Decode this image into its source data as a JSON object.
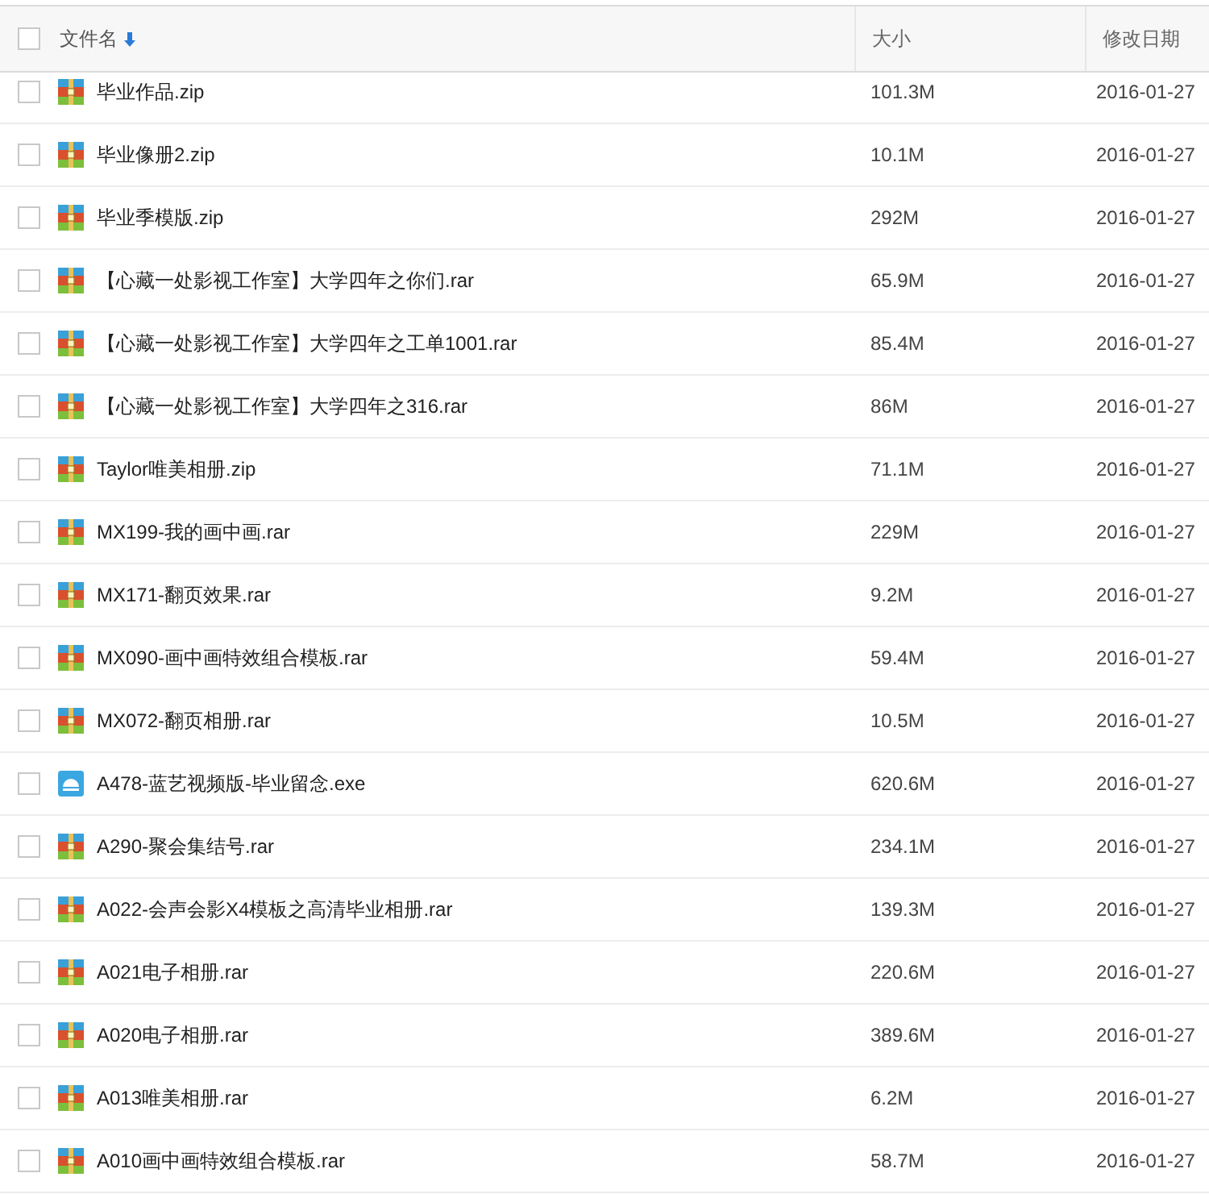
{
  "header": {
    "columns": [
      {
        "label": "文件名",
        "sorted": true
      },
      {
        "label": "大小",
        "sorted": false
      },
      {
        "label": "修改日期",
        "sorted": false
      }
    ],
    "checked": false
  },
  "rows": [
    {
      "name": "毕业作品.zip",
      "size": "101.3M",
      "date": "2016-01-27",
      "kind": "archive",
      "checked": false
    },
    {
      "name": "毕业像册2.zip",
      "size": "10.1M",
      "date": "2016-01-27",
      "kind": "archive",
      "checked": false
    },
    {
      "name": "毕业季模版.zip",
      "size": "292M",
      "date": "2016-01-27",
      "kind": "archive",
      "checked": false
    },
    {
      "name": "【心藏一处影视工作室】大学四年之你们.rar",
      "size": "65.9M",
      "date": "2016-01-27",
      "kind": "archive",
      "checked": false
    },
    {
      "name": "【心藏一处影视工作室】大学四年之工单1001.rar",
      "size": "85.4M",
      "date": "2016-01-27",
      "kind": "archive",
      "checked": false
    },
    {
      "name": "【心藏一处影视工作室】大学四年之316.rar",
      "size": "86M",
      "date": "2016-01-27",
      "kind": "archive",
      "checked": false
    },
    {
      "name": "Taylor唯美相册.zip",
      "size": "71.1M",
      "date": "2016-01-27",
      "kind": "archive",
      "checked": false
    },
    {
      "name": "MX199-我的画中画.rar",
      "size": "229M",
      "date": "2016-01-27",
      "kind": "archive",
      "checked": false
    },
    {
      "name": "MX171-翻页效果.rar",
      "size": "9.2M",
      "date": "2016-01-27",
      "kind": "archive",
      "checked": false
    },
    {
      "name": "MX090-画中画特效组合模板.rar",
      "size": "59.4M",
      "date": "2016-01-27",
      "kind": "archive",
      "checked": false
    },
    {
      "name": "MX072-翻页相册.rar",
      "size": "10.5M",
      "date": "2016-01-27",
      "kind": "archive",
      "checked": false
    },
    {
      "name": "A478-蓝艺视频版-毕业留念.exe",
      "size": "620.6M",
      "date": "2016-01-27",
      "kind": "exe",
      "checked": false
    },
    {
      "name": "A290-聚会集结号.rar",
      "size": "234.1M",
      "date": "2016-01-27",
      "kind": "archive",
      "checked": false
    },
    {
      "name": "A022-会声会影X4模板之高清毕业相册.rar",
      "size": "139.3M",
      "date": "2016-01-27",
      "kind": "archive",
      "checked": false
    },
    {
      "name": "A021电子相册.rar",
      "size": "220.6M",
      "date": "2016-01-27",
      "kind": "archive",
      "checked": false
    },
    {
      "name": "A020电子相册.rar",
      "size": "389.6M",
      "date": "2016-01-27",
      "kind": "archive",
      "checked": false
    },
    {
      "name": "A013唯美相册.rar",
      "size": "6.2M",
      "date": "2016-01-27",
      "kind": "archive",
      "checked": false
    },
    {
      "name": "A010画中画特效组合模板.rar",
      "size": "58.7M",
      "date": "2016-01-27",
      "kind": "archive",
      "checked": false
    }
  ]
}
